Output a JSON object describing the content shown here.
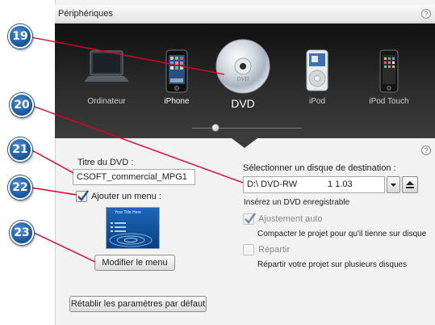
{
  "window": {
    "title": "Périphériques",
    "help_glyph": "?"
  },
  "devices": [
    {
      "name": "Ordinateur",
      "icon": "laptop-icon"
    },
    {
      "name": "iPhone",
      "icon": "iphone-icon"
    },
    {
      "name": "DVD",
      "icon": "dvd-disc-icon",
      "selected": true
    },
    {
      "name": "iPod",
      "icon": "ipod-icon"
    },
    {
      "name": "iPod Touch",
      "icon": "ipod-touch-icon"
    }
  ],
  "dvd_disc_text": "DVD",
  "left_section": {
    "title_label": "Titre du DVD :",
    "title_value": "CSOFT_commercial_MPG1",
    "add_menu_label": "Ajouter un menu :",
    "add_menu_checked": true,
    "menu_preview_title": "Your Title Here",
    "edit_menu_button": "Modifier le menu",
    "reset_button": "Rétablir les paramètres par défaut"
  },
  "right_section": {
    "help_glyph": "?",
    "dest_label": "Sélectionner un disque de destination :",
    "drive_value": "D:\\  DVD-RW",
    "drive_version": "1 1.03",
    "insert_hint": "Insérez un DVD enregistrable",
    "auto_fit_label": "Ajustement auto",
    "auto_fit_checked": true,
    "auto_fit_desc": "Compacter le projet pour qu'il tienne sur disque",
    "split_label": "Répartir",
    "split_checked": false,
    "split_desc": "Répartir votre projet sur plusieurs disques"
  },
  "callouts": [
    "19",
    "20",
    "21",
    "22",
    "23"
  ],
  "colors": {
    "callout_blue": "#1f5fa8",
    "callout_line": "#e0002a",
    "carousel_bg": "#1a1a1a"
  }
}
